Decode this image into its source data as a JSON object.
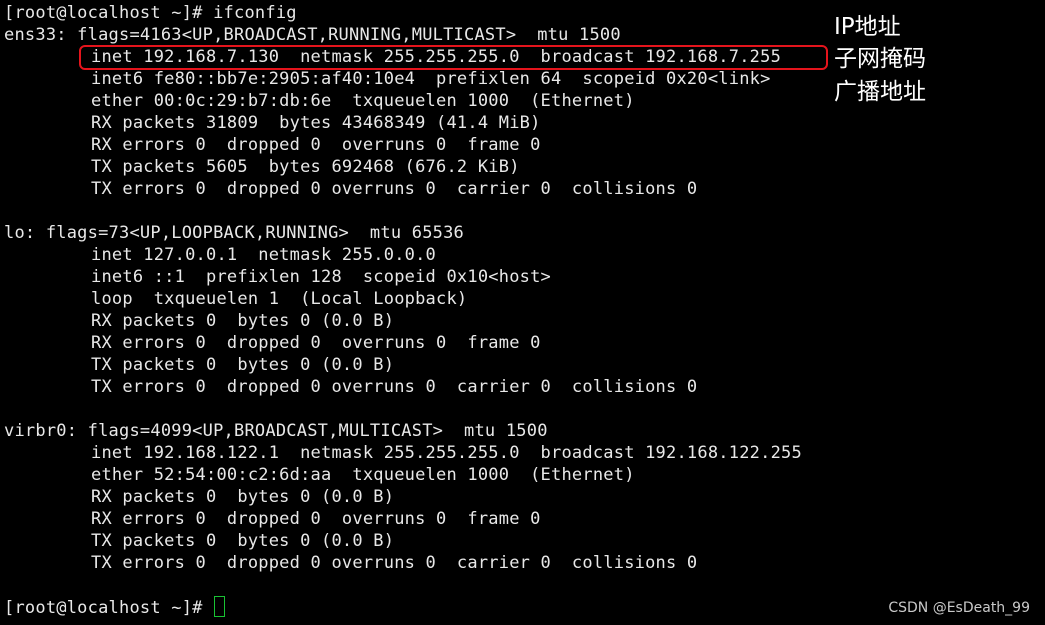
{
  "terminal": {
    "prompt_cmd": "[root@localhost ~]# ifconfig",
    "ens33": {
      "header": "ens33: flags=4163<UP,BROADCAST,RUNNING,MULTICAST>  mtu 1500",
      "inet": "inet 192.168.7.130  netmask 255.255.255.0  broadcast 192.168.7.255",
      "inet6": "inet6 fe80::bb7e:2905:af40:10e4  prefixlen 64  scopeid 0x20<link>",
      "ether": "ether 00:0c:29:b7:db:6e  txqueuelen 1000  (Ethernet)",
      "rx_packets": "RX packets 31809  bytes 43468349 (41.4 MiB)",
      "rx_errors": "RX errors 0  dropped 0  overruns 0  frame 0",
      "tx_packets": "TX packets 5605  bytes 692468 (676.2 KiB)",
      "tx_errors": "TX errors 0  dropped 0 overruns 0  carrier 0  collisions 0"
    },
    "lo": {
      "header": "lo: flags=73<UP,LOOPBACK,RUNNING>  mtu 65536",
      "inet": "inet 127.0.0.1  netmask 255.0.0.0",
      "inet6": "inet6 ::1  prefixlen 128  scopeid 0x10<host>",
      "loop": "loop  txqueuelen 1  (Local Loopback)",
      "rx_packets": "RX packets 0  bytes 0 (0.0 B)",
      "rx_errors": "RX errors 0  dropped 0  overruns 0  frame 0",
      "tx_packets": "TX packets 0  bytes 0 (0.0 B)",
      "tx_errors": "TX errors 0  dropped 0 overruns 0  carrier 0  collisions 0"
    },
    "virbr0": {
      "header": "virbr0: flags=4099<UP,BROADCAST,MULTICAST>  mtu 1500",
      "inet": "inet 192.168.122.1  netmask 255.255.255.0  broadcast 192.168.122.255",
      "ether": "ether 52:54:00:c2:6d:aa  txqueuelen 1000  (Ethernet)",
      "rx_packets": "RX packets 0  bytes 0 (0.0 B)",
      "rx_errors": "RX errors 0  dropped 0  overruns 0  frame 0",
      "tx_packets": "TX packets 0  bytes 0 (0.0 B)",
      "tx_errors": "TX errors 0  dropped 0 overruns 0  carrier 0  collisions 0"
    },
    "final_prompt": "[root@localhost ~]# "
  },
  "annotations": {
    "ip_address": "IP地址",
    "subnet_mask": "子网掩码",
    "broadcast_address": "广播地址"
  },
  "watermark": "CSDN @EsDeath_99",
  "colors": {
    "background": "#000000",
    "text": "#e8e8e8",
    "highlight_box": "#e5141c",
    "cursor": "#19c233",
    "annotation": "#ffffff"
  }
}
